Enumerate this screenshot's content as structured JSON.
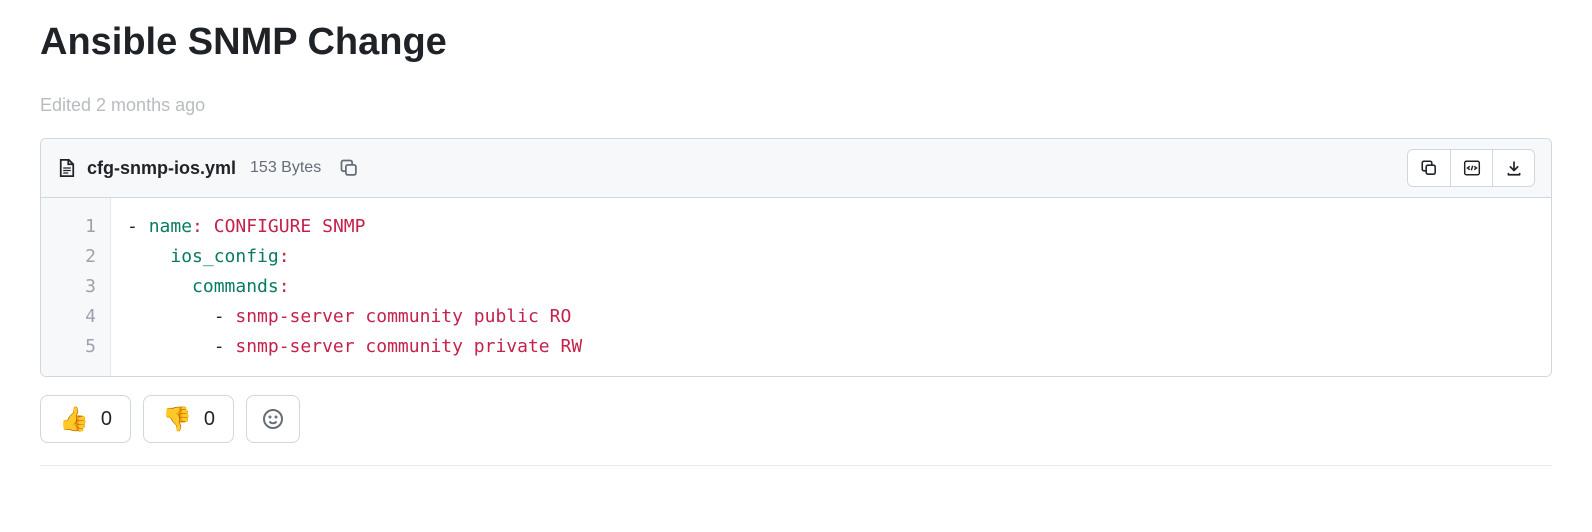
{
  "title": "Ansible SNMP Change",
  "edited_text": "Edited 2 months ago",
  "file": {
    "name": "cfg-snmp-ios.yml",
    "size_label": "153 Bytes"
  },
  "code": {
    "lines": [
      {
        "num": "1",
        "indent": "",
        "dash": "- ",
        "key": "name",
        "colon": ": ",
        "val": "CONFIGURE SNMP"
      },
      {
        "num": "2",
        "indent": "    ",
        "dash": "",
        "key": "ios_config",
        "colon": ":",
        "val": ""
      },
      {
        "num": "3",
        "indent": "      ",
        "dash": "",
        "key": "commands",
        "colon": ":",
        "val": ""
      },
      {
        "num": "4",
        "indent": "        ",
        "dash": "- ",
        "key": "",
        "colon": "",
        "val": "snmp-server community public RO"
      },
      {
        "num": "5",
        "indent": "        ",
        "dash": "- ",
        "key": "",
        "colon": "",
        "val": "snmp-server community private RW"
      }
    ]
  },
  "reactions": {
    "thumbs_up": {
      "emoji": "👍",
      "count": "0"
    },
    "thumbs_down": {
      "emoji": "👎",
      "count": "0"
    }
  }
}
